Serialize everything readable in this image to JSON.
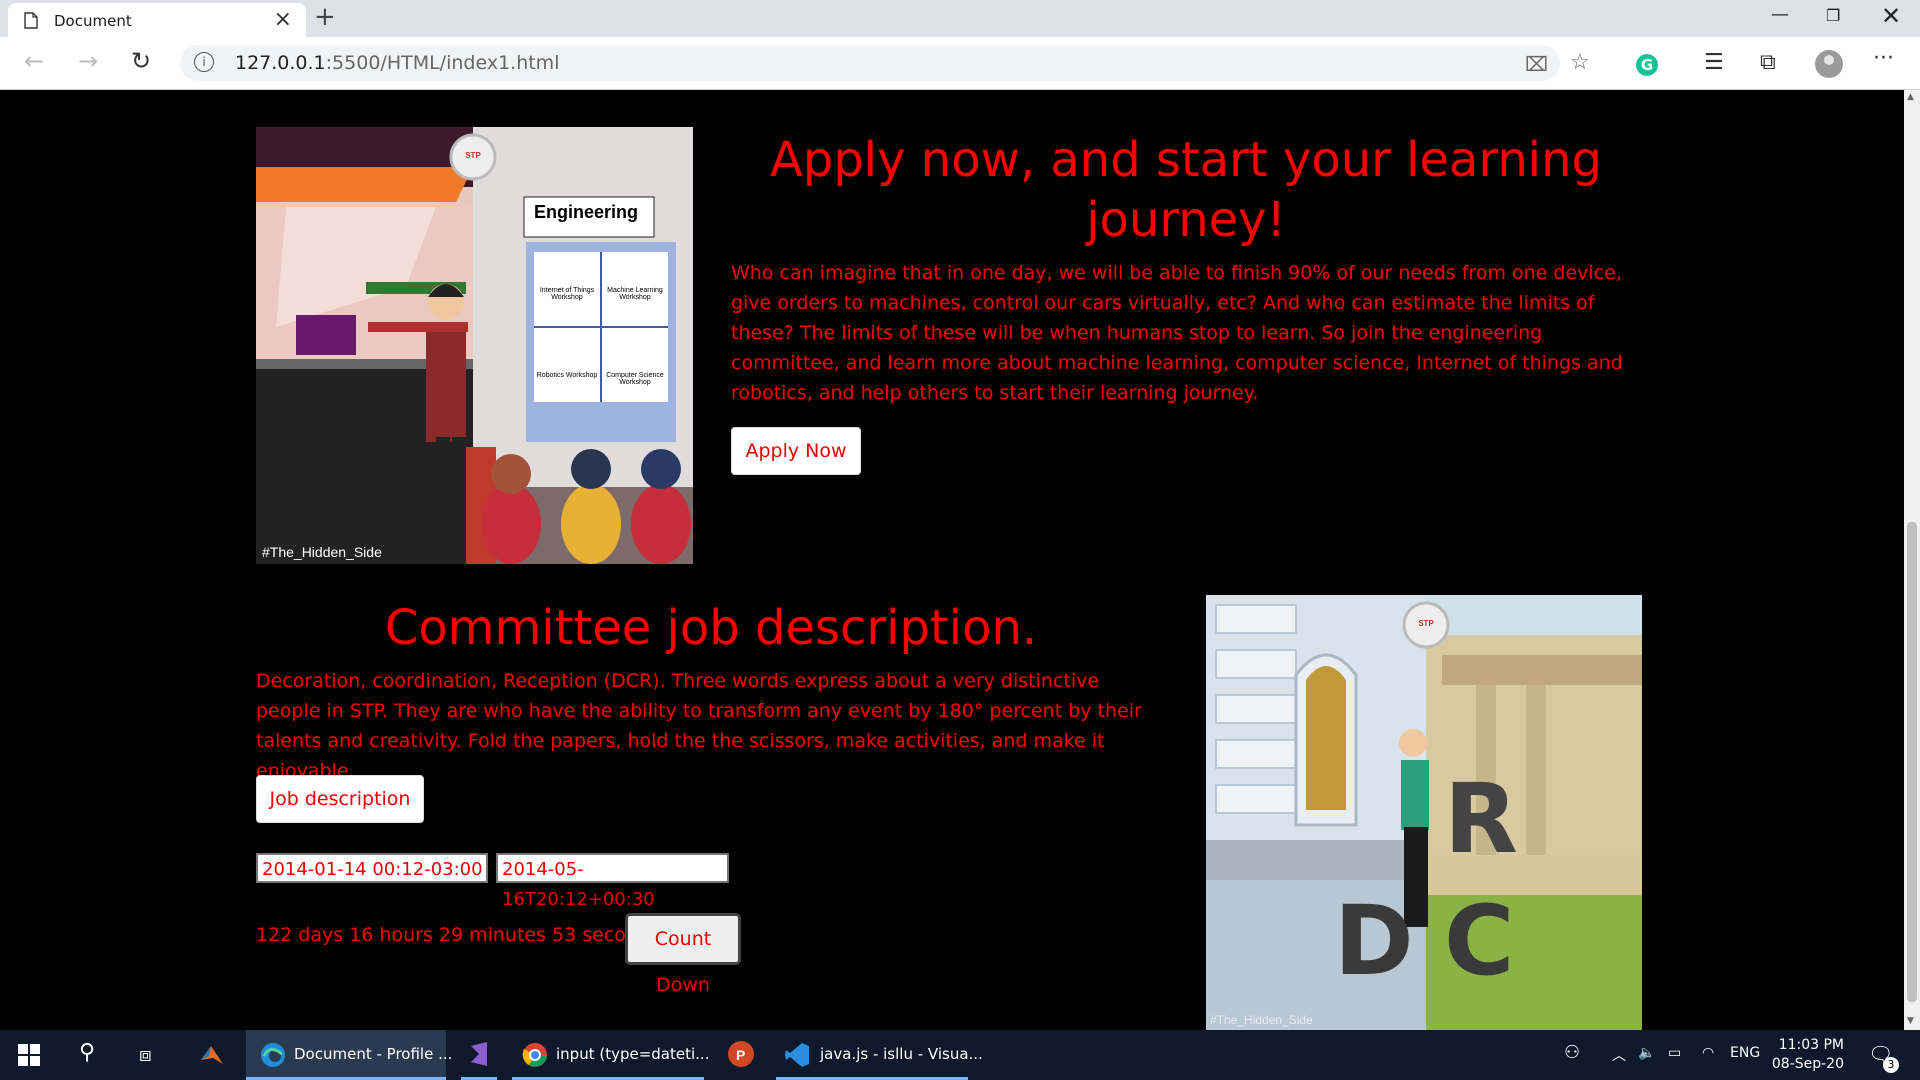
{
  "browser": {
    "tab_title": "Document",
    "url_host": "127.0.0.1",
    "url_path": ":5500/HTML/index1.html"
  },
  "section1": {
    "heading": "Apply now, and start your learning journey!",
    "paragraph": "Who can imagine that in one day, we will be able to finish 90% of our needs from one device, give orders to machines, control our cars virtually, etc? And who can estimate the limits of these? The limits of these will be when humans stop to learn. So join the engineering committee, and learn more about machine learning, computer science, Internet of things and robotics, and help others to start their learning journey.",
    "button_label": "Apply Now",
    "image": {
      "sign_title": "Engineering",
      "workshops": [
        "Internet of Things Workshop",
        "Machine Learning Workshop",
        "Robotics Workshop",
        "Computer Science Workshop"
      ],
      "logo_text": "STP",
      "watermark": "#The_Hidden_Side"
    }
  },
  "section2": {
    "heading": "Committee job description.",
    "paragraph": "Decoration, coordination, Reception (DCR). Three words express about a very distinctive people in STP. They are who have the ability to transform any event by 180° percent by their talents and creativity. Fold the papers, hold the the scissors, make activities, and make it enjoyable.",
    "button_label": "Job description",
    "datetime_start": "2014-01-14 00:12-03:00",
    "datetime_end": "2014-05-16T20:12+00:30",
    "countdown_text": "122 days 16 hours 29 minutes 53 seconds",
    "countdown_button": "Count Down",
    "image": {
      "letters": [
        "R",
        "D",
        "C"
      ],
      "logo_text": "STP",
      "watermark": "#The_Hidden_Side"
    }
  },
  "taskbar": {
    "items": [
      {
        "label": "Document - Profile ..."
      },
      {
        "label": "input (type=dateti..."
      },
      {
        "label": "java.js - isllu - Visua..."
      }
    ],
    "language": "ENG",
    "time": "11:03 PM",
    "date": "08-Sep-20",
    "notification_count": "3"
  },
  "colors": {
    "text_accent": "#ff0000",
    "page_bg": "#000000",
    "taskbar_bg": "#0e1a2b"
  }
}
